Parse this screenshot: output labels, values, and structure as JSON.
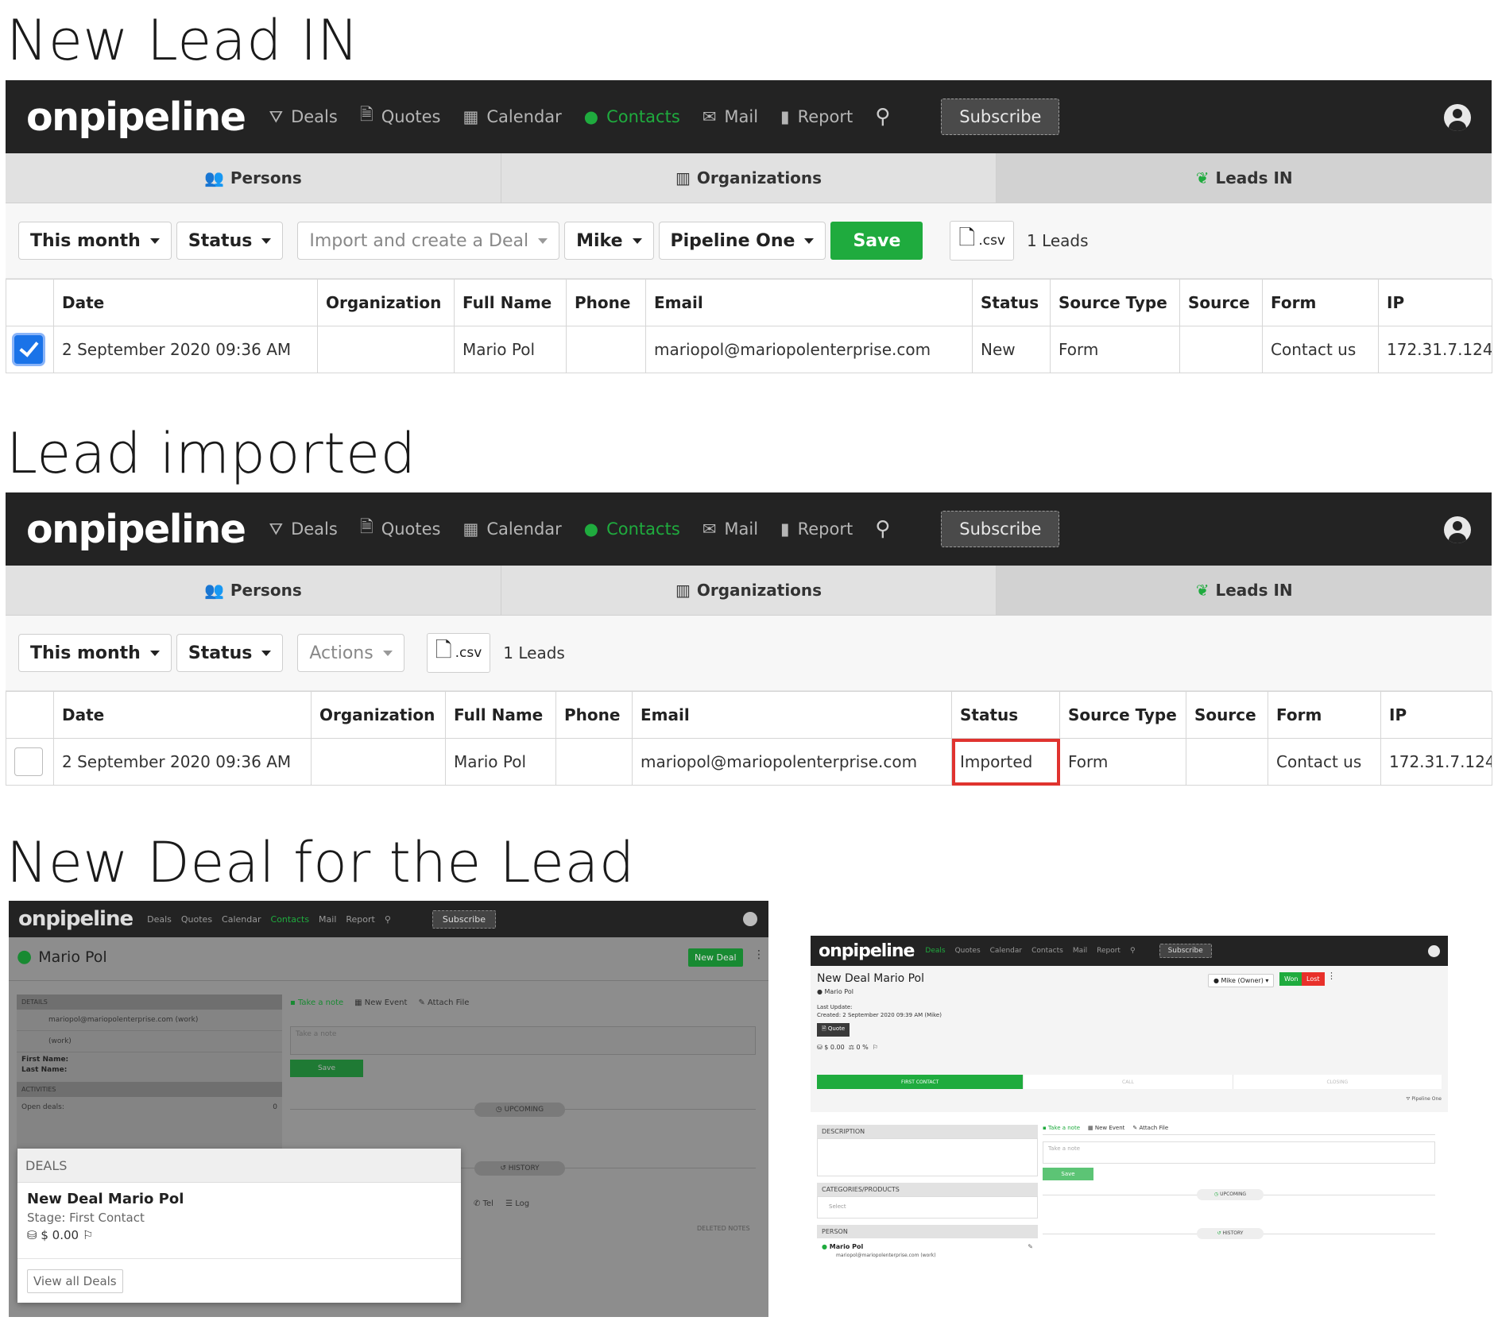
{
  "headings": {
    "h1": "New Lead IN",
    "h2": "Lead imported",
    "h3": "New Deal for the Lead"
  },
  "nav": {
    "logo": "onpipeline",
    "items": [
      "Deals",
      "Quotes",
      "Calendar",
      "Contacts",
      "Mail",
      "Report"
    ],
    "active": "Contacts",
    "subscribe": "Subscribe"
  },
  "tabs": {
    "persons": "Persons",
    "organizations": "Organizations",
    "leads_in": "Leads IN"
  },
  "panel1": {
    "filters": [
      "This month",
      "Status"
    ],
    "import_select": "Import and create a Deal",
    "owner_select": "Mike",
    "pipeline_select": "Pipeline One",
    "save": "Save",
    "csv": ".csv",
    "count": "1 Leads",
    "checked": true
  },
  "panel2": {
    "filters": [
      "This month",
      "Status"
    ],
    "actions": "Actions",
    "csv": ".csv",
    "count": "1 Leads",
    "checked": false
  },
  "table": {
    "columns": [
      "",
      "Date",
      "Organization",
      "Full Name",
      "Phone",
      "Email",
      "Status",
      "Source Type",
      "Source",
      "Form",
      "IP"
    ],
    "row": {
      "date": "2 September 2020 09:36 AM",
      "organization": "",
      "full_name": "Mario Pol",
      "phone": "",
      "email": "mariopol@mariopolenterprise.com",
      "status_new": "New",
      "status_imported": "Imported",
      "source_type": "Form",
      "source": "",
      "form": "Contact us",
      "ip": "172.31.7.124"
    }
  },
  "contact_view": {
    "name": "Mario Pol",
    "new_deal_button": "New Deal",
    "details_header": "DETAILS",
    "email": "mariopol@mariopolenterprise.com",
    "email_tag": "(work)",
    "phone_tag": "(work)",
    "first_name_label": "First Name:",
    "last_name_label": "Last Name:",
    "activities_header": "ACTIVITIES",
    "open_deals_label": "Open deals:",
    "open_deals_value": "0",
    "take_note": "Take a note",
    "new_event": "New Event",
    "attach_file": "Attach File",
    "note_placeholder": "Take a note",
    "save": "Save",
    "upcoming": "UPCOMING",
    "history": "HISTORY",
    "tel": "Tel",
    "log": "Log",
    "deleted_notes": "DELETED NOTES",
    "deals_card": {
      "header": "DEALS",
      "deal_title": "New Deal Mario Pol",
      "stage": "Stage: First Contact",
      "amount": "$ 0.00",
      "view_all": "View all Deals"
    }
  },
  "deal_view": {
    "title": "New Deal Mario Pol",
    "person": "Mario Pol",
    "last_update": "Last Update:",
    "created": "Created: 2 September 2020 09:39 AM (Mike)",
    "quote": "Quote",
    "amount": "$ 0.00",
    "percent": "0 %",
    "owner": "Mike (Owner)",
    "won": "Won",
    "lost": "Lost",
    "stages": [
      "FIRST CONTACT",
      "CALL",
      "CLOSING"
    ],
    "pipeline": "Pipeline One",
    "description_header": "DESCRIPTION",
    "categories_header": "CATEGORIES/PRODUCTS",
    "select_placeholder": "Select",
    "person_header": "PERSON",
    "person_email": "mariopol@mariopolenterprise.com",
    "person_email_tag": "(work)",
    "take_note": "Take a note",
    "new_event": "New Event",
    "attach_file": "Attach File",
    "note_placeholder": "Take a note",
    "save": "Save",
    "upcoming": "UPCOMING",
    "history": "HISTORY"
  },
  "colors": {
    "brand_green": "#1fab3e",
    "topbar": "#232323",
    "highlight_red": "#e0332f",
    "lost_red": "#e8302a"
  }
}
